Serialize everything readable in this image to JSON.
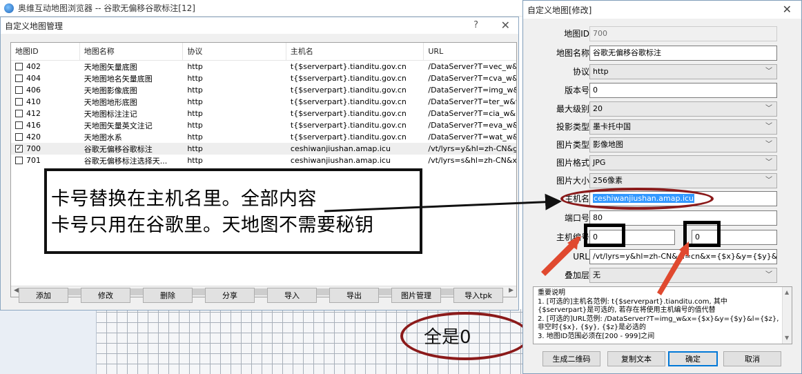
{
  "app": {
    "title": "奥维互动地图浏览器 -- 谷歌无偏移谷歌标注[12]"
  },
  "manager": {
    "title": "自定义地图管理",
    "help": "?",
    "close": "✕",
    "columns": [
      "地图ID",
      "地图名称",
      "协议",
      "主机名",
      "URL"
    ],
    "rows": [
      {
        "id": "402",
        "name": "天地图矢量底图",
        "protocol": "http",
        "host": "t{$serverpart}.tianditu.gov.cn",
        "url": "/DataServer?T=vec_w&tk",
        "checked": false
      },
      {
        "id": "404",
        "name": "天地图地名矢量底图",
        "protocol": "http",
        "host": "t{$serverpart}.tianditu.gov.cn",
        "url": "/DataServer?T=cva_w&tk",
        "checked": false
      },
      {
        "id": "406",
        "name": "天地图影像底图",
        "protocol": "http",
        "host": "t{$serverpart}.tianditu.gov.cn",
        "url": "/DataServer?T=img_w&tk",
        "checked": false
      },
      {
        "id": "410",
        "name": "天地图地形底图",
        "protocol": "http",
        "host": "t{$serverpart}.tianditu.gov.cn",
        "url": "/DataServer?T=ter_w&tk.",
        "checked": false
      },
      {
        "id": "412",
        "name": "天地图标注注记",
        "protocol": "http",
        "host": "t{$serverpart}.tianditu.gov.cn",
        "url": "/DataServer?T=cia_w&",
        "checked": false
      },
      {
        "id": "416",
        "name": "天地图矢量英文注记",
        "protocol": "http",
        "host": "t{$serverpart}.tianditu.gov.cn",
        "url": "/DataServer?T=eva_w&tk",
        "checked": false
      },
      {
        "id": "420",
        "name": "天地图水系",
        "protocol": "http",
        "host": "t{$serverpart}.tianditu.gov.cn",
        "url": "/DataServer?T=wat_w&tk",
        "checked": false
      },
      {
        "id": "700",
        "name": "谷歌无偏移谷歌标注",
        "protocol": "http",
        "host": "ceshiwanjiushan.amap.icu",
        "url": "/vt/lyrs=y&hl=zh-CN&gl=",
        "checked": true
      },
      {
        "id": "701",
        "name": "谷歌无偏移标注选择天...",
        "protocol": "http",
        "host": "ceshiwanjiushan.amap.icu",
        "url": "/vt/lyrs=s&hl=zh-CN&x={",
        "checked": false
      }
    ],
    "buttons": [
      "添加",
      "修改",
      "删除",
      "分享",
      "导入",
      "导出",
      "图片管理",
      "导入tpk"
    ]
  },
  "annotation": {
    "line1": "卡号替换在主机名里。全部内容",
    "line2": "卡号只用在谷歌里。天地图不需要秘钥",
    "zero_note": "全是0"
  },
  "edit": {
    "title": "自定义地图[修改]",
    "close": "✕",
    "fields": {
      "map_id": {
        "label": "地图ID",
        "value": "700"
      },
      "map_name": {
        "label": "地图名称",
        "value": "谷歌无偏移谷歌标注"
      },
      "protocol": {
        "label": "协议",
        "value": "http"
      },
      "version": {
        "label": "版本号",
        "value": "0"
      },
      "max_level": {
        "label": "最大级别",
        "value": "20"
      },
      "projection": {
        "label": "投影类型",
        "value": "墨卡托中国"
      },
      "image_type": {
        "label": "图片类型",
        "value": "影像地图"
      },
      "image_format": {
        "label": "图片格式",
        "value": "JPG"
      },
      "image_size": {
        "label": "图片大小",
        "value": "256像素"
      },
      "host": {
        "label": "主机名",
        "value": "ceshiwanjiushan.amap.icu"
      },
      "port": {
        "label": "端口号",
        "value": "80"
      },
      "host_index": {
        "label": "主机编号",
        "value_a": "0",
        "value_b": "0"
      },
      "url": {
        "label": "URL",
        "value": "/vt/lyrs=y&hl=zh-CN&gl=cn&x={$x}&y={$y}&z={$z}"
      },
      "overlay": {
        "label": "叠加层",
        "value": "无"
      }
    },
    "notes": {
      "title": "重要说明",
      "lines": [
        "1. [可选的]主机名范例: t{$serverpart}.tianditu.com, 其中",
        "{$serverpart}是可选的, 若存在将使用主机编号的值代替",
        "2. [可选的]URL范例: /DataServer?T=img_w&x={$x}&y={$y}&l={$z},",
        "非空时{$x}, {$y}, {$z}是必选的",
        "3. 地图ID范围必须在[200 - 999]之间"
      ]
    },
    "buttons": {
      "qr": "生成二维码",
      "copy": "复制文本",
      "ok": "确定",
      "cancel": "取消"
    }
  }
}
